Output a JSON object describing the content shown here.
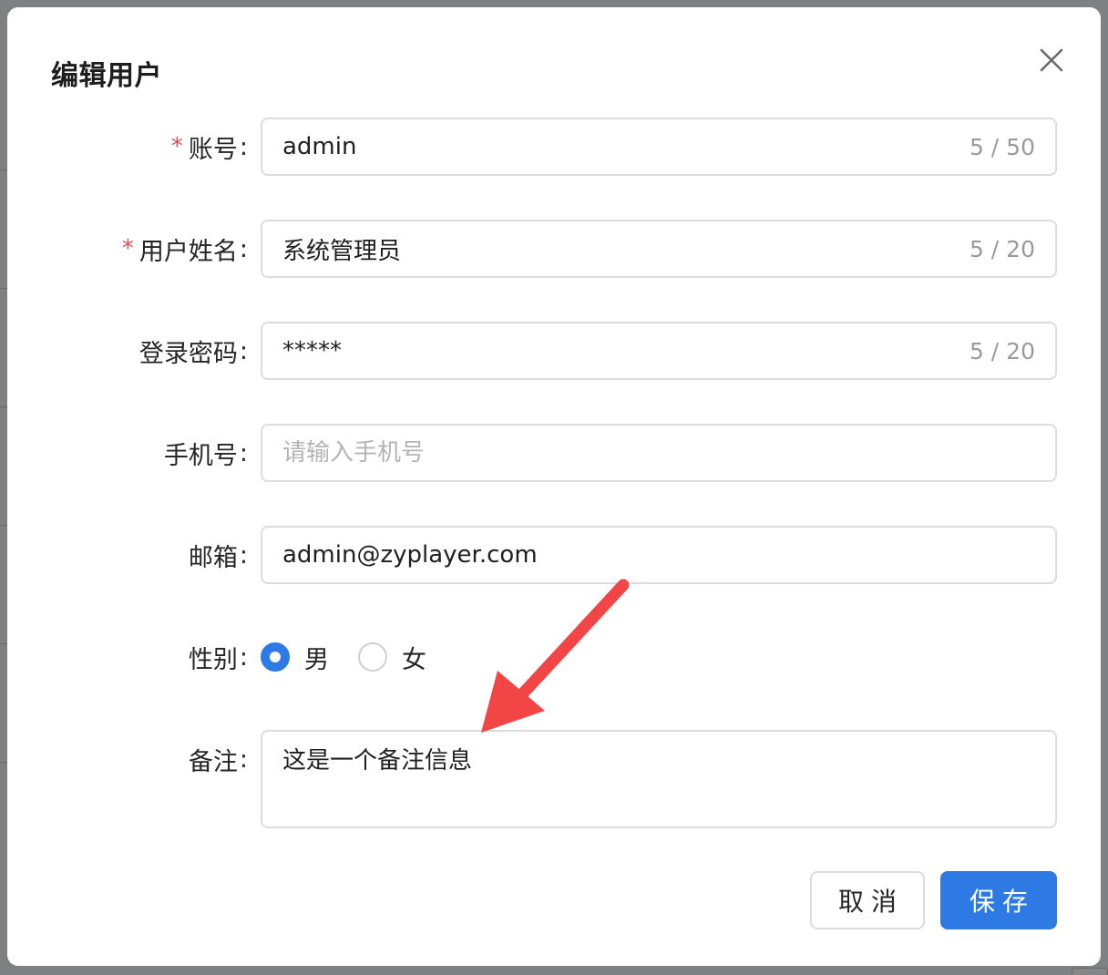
{
  "dialog": {
    "title": "编辑用户",
    "close_icon": "close-icon"
  },
  "form": {
    "account": {
      "label": "账号",
      "required": true,
      "value": "admin",
      "counter": "5 / 50"
    },
    "username": {
      "label": "用户姓名",
      "required": true,
      "value": "系统管理员",
      "counter": "5 / 20"
    },
    "password": {
      "label": "登录密码",
      "required": false,
      "value": "*****",
      "counter": "5 / 20"
    },
    "phone": {
      "label": "手机号",
      "required": false,
      "value": "",
      "placeholder": "请输入手机号"
    },
    "email": {
      "label": "邮箱",
      "required": false,
      "value": "admin@zyplayer.com"
    },
    "gender": {
      "label": "性别",
      "options": [
        {
          "label": "男",
          "checked": true
        },
        {
          "label": "女",
          "checked": false
        }
      ]
    },
    "remark": {
      "label": "备注",
      "value": "这是一个备注信息"
    },
    "required_mark": "*",
    "colon": ":"
  },
  "buttons": {
    "cancel": "取消",
    "save": "保存"
  },
  "colors": {
    "primary": "#2e7ae4",
    "required": "#e34d59",
    "annotation_arrow": "#f24646"
  }
}
